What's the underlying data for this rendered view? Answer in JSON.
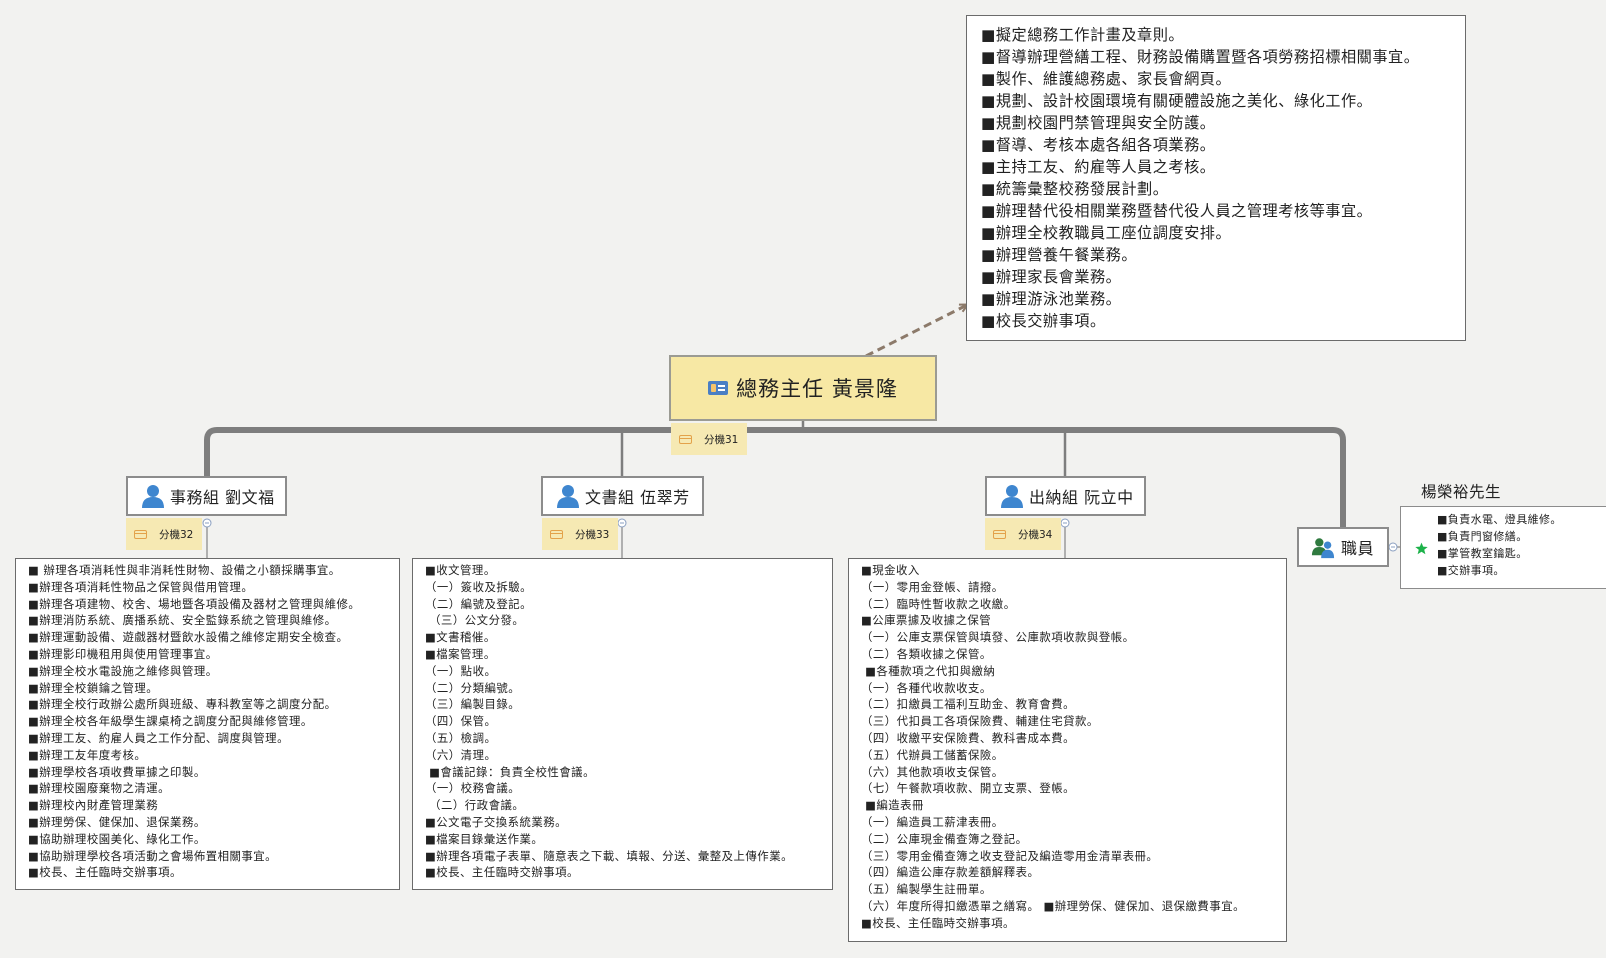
{
  "root": {
    "title": "總務主任 黃景隆",
    "ext": "分機31"
  },
  "duties_box": {
    "items": [
      "■擬定總務工作計畫及章則。",
      "■督導辦理營繕工程、財務設備購置暨各項勞務招標相關事宜。",
      "■製作、維護總務處、家長會網頁。",
      "■規劃、設計校園環境有關硬體設施之美化、綠化工作。",
      "■規劃校園門禁管理與安全防護。",
      "■督導、考核本處各組各項業務。",
      "■主持工友、約雇等人員之考核。",
      "■統籌彙整校務發展計劃。",
      "■辦理替代役相關業務暨替代役人員之管理考核等事宜。",
      "■辦理全校教職員工座位調度安排。",
      "■辦理營養午餐業務。",
      "■辦理家長會業務。",
      "■辦理游泳池業務。",
      "■校長交辦事項。"
    ]
  },
  "branches": [
    {
      "title": "事務組 劉文福",
      "ext": "分機32",
      "items": [
        "■ 辦理各項消耗性與非消耗性財物、設備之小額採購事宜。",
        "■辦理各項消耗性物品之保管與借用管理。",
        "■辦理各項建物、校舍、場地暨各項設備及器材之管理與維修。",
        "■辦理消防系統、廣播系統、安全監錄系統之管理與維修。",
        "■辦理運動設備、遊戲器材暨飲水設備之維修定期安全檢查。",
        "■辦理影印機租用與使用管理事宜。",
        "■辦理全校水電設施之維修與管理。",
        "■辦理全校鎖鑰之管理。",
        "■辦理全校行政辦公處所與班級、專科教室等之調度分配。",
        "■辦理全校各年級學生課桌椅之調度分配與維修管理。",
        "■辦理工友、約雇人員之工作分配、調度與管理。",
        "■辦理工友年度考核。",
        "■辦理學校各項收費單據之印製。",
        "■辦理校園廢棄物之清運。",
        "■辦理校內財產管理業務",
        "■辦理勞保、健保加、退保業務。",
        "■協助辦理校園美化、綠化工作。",
        "■協助辦理學校各項活動之會場佈置相關事宜。",
        "■校長、主任臨時交辦事項。"
      ]
    },
    {
      "title": "文書組 伍翠芳",
      "ext": "分機33",
      "items": [
        "■收文管理。",
        "（一）簽收及拆驗。",
        "（二）編號及登記。",
        " （三）公文分發。",
        "■文書稽催。",
        "■檔案管理。",
        "（一）點收。",
        "（二）分類編號。",
        "（三）編製目錄。",
        "（四）保管。",
        "（五）檢調。",
        "（六）清理。",
        " ■會議記錄：負責全校性會議。",
        "（一）校務會議。",
        " （二）行政會議。",
        "■公文電子交換系統業務。",
        "■檔案目錄彙送作業。",
        "■辦理各項電子表單、隨意表之下載、填報、分送、彙整及上傳作業。",
        "■校長、主任臨時交辦事項。"
      ]
    },
    {
      "title": "出納組 阮立中",
      "ext": "分機34",
      "items": [
        "■現金收入",
        "（一）零用金登帳、請撥。",
        "（二）臨時性暫收款之收繳。",
        "■公庫票據及收據之保管",
        "（一）公庫支票保管與填發、公庫款項收款與登帳。",
        "（二）各類收據之保管。",
        " ■各種款項之代扣與繳納",
        "（一）各種代收款收支。",
        "（二）扣繳員工福利互助金、教育會費。",
        "（三）代扣員工各項保險費、輔建住宅貸款。",
        "（四）收繳平安保險費、教科書成本費。",
        "（五）代辦員工儲蓄保險。",
        "（六）其他款項收支保管。",
        "（七）午餐款項收款、開立支票、登帳。",
        " ■編造表冊",
        "（一）編造員工薪津表冊。",
        "（二）公庫現金備查簿之登記。",
        "（三）零用金備查簿之收支登記及編造零用金清單表冊。",
        "（四）編造公庫存款差額解釋表。",
        "（五）編製學生註冊單。",
        "（六）年度所得扣繳憑單之繕寫。 ■辦理勞保、健保加、退保繳費事宜。",
        "■校長、主任臨時交辦事項。"
      ]
    }
  ],
  "staff": {
    "title": "職員",
    "person": "楊榮裕先生",
    "items": [
      "■負責水電、燈具維修。",
      "■負責門窗修繕。",
      "■掌管教室鑰匙。",
      "■交辦事項。"
    ]
  }
}
